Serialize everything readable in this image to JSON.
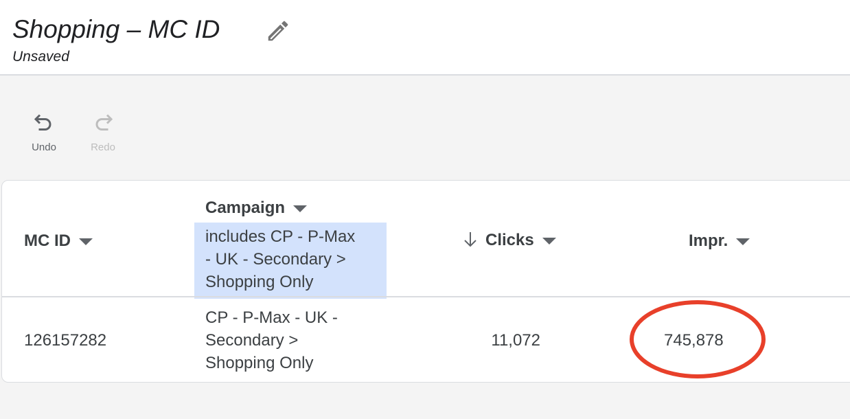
{
  "header": {
    "title": "Shopping – MC ID",
    "status": "Unsaved",
    "edit_icon": "pencil-icon"
  },
  "toolbar": {
    "undo_label": "Undo",
    "redo_label": "Redo"
  },
  "table": {
    "columns": [
      {
        "label": "MC ID"
      },
      {
        "label": "Campaign",
        "filter_lines": [
          "includes CP - P-Max",
          "- UK - Secondary >",
          "Shopping Only"
        ]
      },
      {
        "label": "Clicks",
        "sort": "descending"
      },
      {
        "label": "Impr."
      }
    ],
    "rows": [
      {
        "mc_id": "126157282",
        "campaign_lines": [
          "CP - P-Max - UK -",
          "Secondary >",
          "Shopping Only"
        ],
        "clicks": "11,072",
        "impr": "745,878"
      }
    ]
  },
  "colors": {
    "filter_bg": "#d3e2fc",
    "highlight_circle": "#e8402a"
  }
}
